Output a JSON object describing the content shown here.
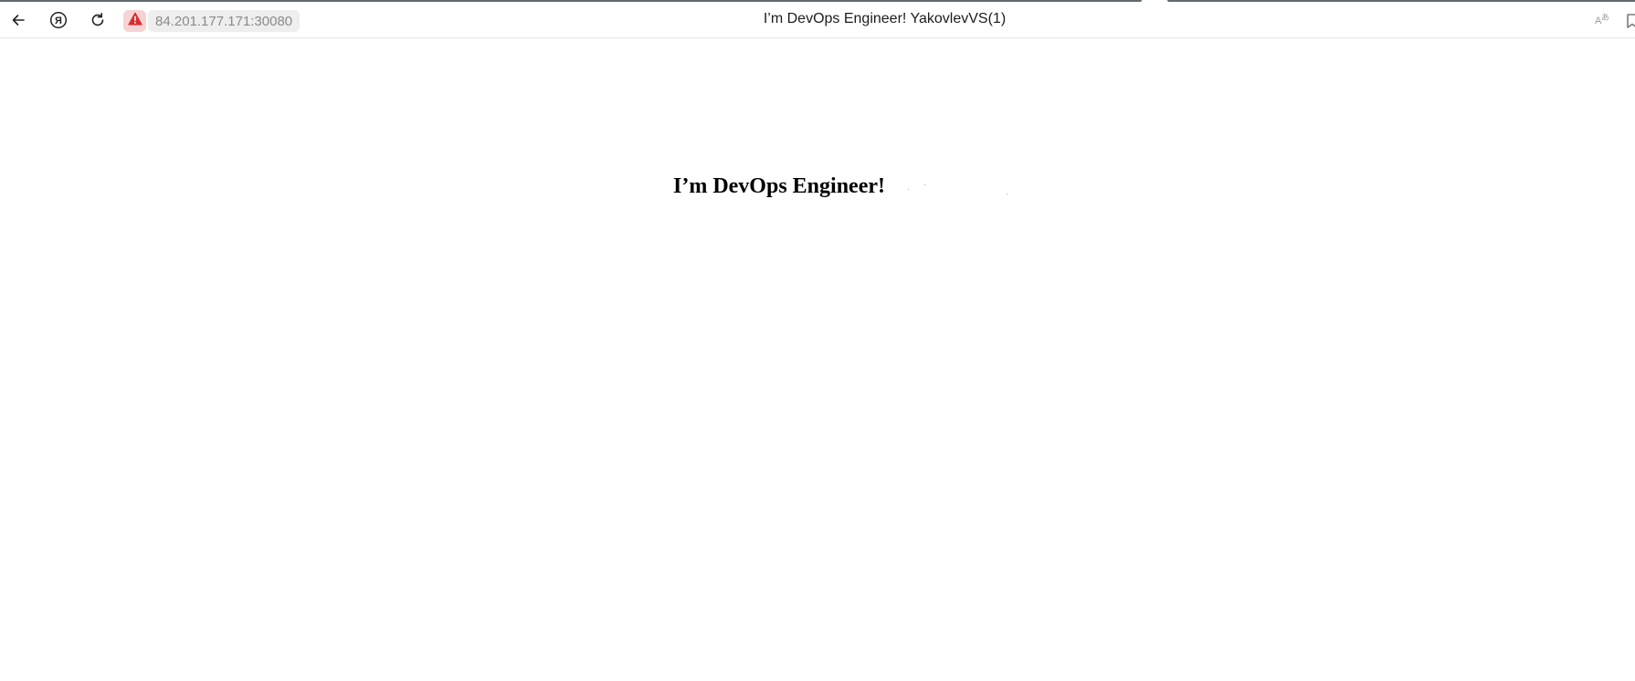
{
  "browser": {
    "address": "84.201.177.171:30080",
    "window_title": "I’m DevOps Engineer! YakovlevVS(1)",
    "security_status": "not-secure",
    "icons": {
      "back": "arrow-left-icon",
      "yandex": "yandex-logo-icon",
      "reload": "reload-icon",
      "security": "warning-triangle-icon",
      "translate": "translate-icon",
      "bookmark": "bookmark-icon"
    },
    "colors": {
      "warning_badge_bg": "#f6d3d3",
      "warning_icon": "#d92d2d",
      "address_bg": "#eeeeee",
      "address_text": "#8a8a8a"
    }
  },
  "page": {
    "heading": "I’m DevOps Engineer!"
  }
}
